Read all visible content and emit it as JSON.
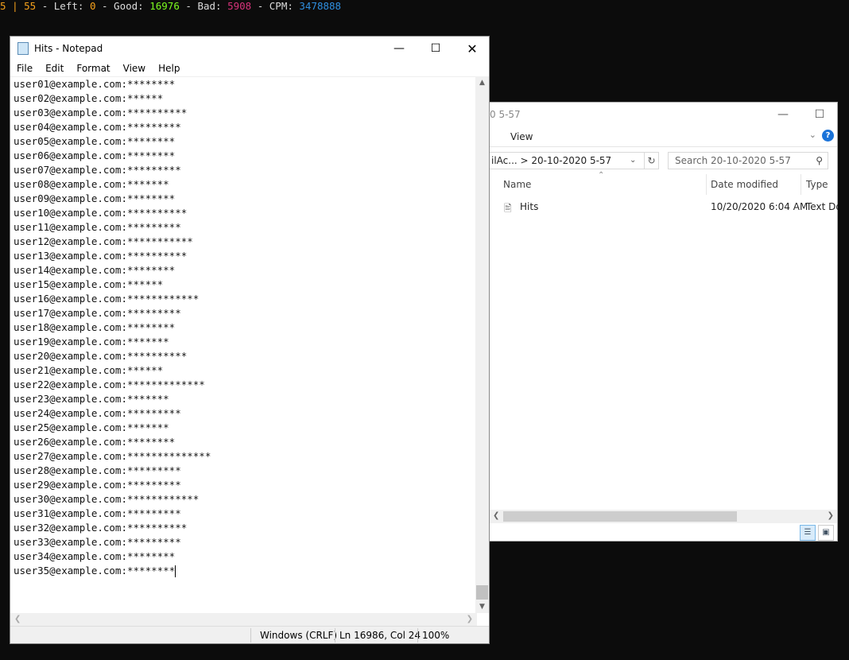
{
  "console": {
    "a": "5",
    "sep": "|",
    "b": "55",
    "left_label": "Left:",
    "left": "0",
    "good_label": "Good:",
    "good": "16976",
    "bad_label": "Bad:",
    "bad": "5908",
    "cpm_label": "CPM:",
    "cpm": "3478888"
  },
  "explorer": {
    "title": "0 5-57",
    "menu_view": "View",
    "address": "ilAc...  >  20-10-2020 5-57",
    "search_placeholder": "Search 20-10-2020 5-57",
    "columns": [
      "Name",
      "Date modified",
      "Type"
    ],
    "file": {
      "name": "Hits",
      "date": "10/20/2020 6:04 AM",
      "type": "Text Do"
    }
  },
  "notepad": {
    "title": "Hits - Notepad",
    "menu": [
      "File",
      "Edit",
      "Format",
      "View",
      "Help"
    ],
    "lines": [
      "user01@example.com:********",
      "user02@example.com:******",
      "user03@example.com:**********",
      "user04@example.com:*********",
      "user05@example.com:********",
      "user06@example.com:********",
      "user07@example.com:*********",
      "user08@example.com:*******",
      "user09@example.com:********",
      "user10@example.com:**********",
      "user11@example.com:*********",
      "user12@example.com:***********",
      "user13@example.com:**********",
      "user14@example.com:********",
      "user15@example.com:******",
      "user16@example.com:************",
      "user17@example.com:*********",
      "user18@example.com:********",
      "user19@example.com:*******",
      "user20@example.com:**********",
      "user21@example.com:******",
      "user22@example.com:*************",
      "user23@example.com:*******",
      "user24@example.com:*********",
      "user25@example.com:*******",
      "user26@example.com:********",
      "user27@example.com:**************",
      "user28@example.com:*********",
      "user29@example.com:*********",
      "user30@example.com:************",
      "user31@example.com:*********",
      "user32@example.com:**********",
      "user33@example.com:*********",
      "user34@example.com:********",
      "user35@example.com:********"
    ],
    "status": {
      "eol": "Windows (CRLF)",
      "position": "Ln 16986, Col 24",
      "zoom": "100%"
    }
  }
}
